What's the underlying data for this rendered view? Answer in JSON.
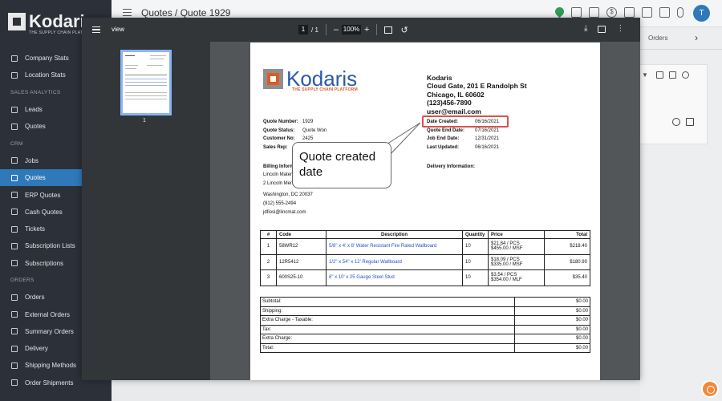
{
  "sidebar": {
    "logo_text": "Kodaris",
    "logo_sub": "THE SUPPLY CHAIN PLATFORM",
    "items": [
      {
        "label": "Company Stats"
      },
      {
        "label": "Location Stats"
      },
      {
        "section": "SALES ANALYTICS"
      },
      {
        "label": "Leads"
      },
      {
        "label": "Quotes"
      },
      {
        "section": "CRM"
      },
      {
        "label": "Jobs"
      },
      {
        "label": "Quotes",
        "active": true
      },
      {
        "label": "ERP Quotes"
      },
      {
        "label": "Cash Quotes"
      },
      {
        "label": "Tickets"
      },
      {
        "label": "Subscription Lists"
      },
      {
        "label": "Subscriptions"
      },
      {
        "section": "ORDERS"
      },
      {
        "label": "Orders"
      },
      {
        "label": "External Orders"
      },
      {
        "label": "Summary Orders"
      },
      {
        "label": "Delivery"
      },
      {
        "label": "Shipping Methods"
      },
      {
        "label": "Order Shipments"
      }
    ]
  },
  "topbar": {
    "title": "Quotes / Quote 1929",
    "avatar_initial": "T",
    "icons": [
      "location-icon",
      "truck-icon",
      "calendar-icon",
      "dollar-icon",
      "mail-icon",
      "chat-icon",
      "document-icon",
      "paperclip-icon"
    ]
  },
  "background": {
    "tab_orders": "Orders",
    "tab_next": "›"
  },
  "viewer": {
    "name": "view",
    "page_current": "1",
    "page_total": "/ 1",
    "zoom": "100%",
    "zoom_out": "–",
    "zoom_in": "+",
    "thumb_page": "1"
  },
  "document": {
    "logo_text": "Kodaris",
    "logo_sub": "THE SUPPLY CHAIN PLATFORM",
    "company": {
      "name": "Kodaris",
      "address1": "Cloud Gate, 201 E Randolph St",
      "address2": "Chicago, IL 60602",
      "phone": "(123)456-7890",
      "email": "user@email.com"
    },
    "quote_info": [
      {
        "key": "Quote Number:",
        "value": "1929"
      },
      {
        "key": "Quote Status:",
        "value": "Quote Won"
      },
      {
        "key": "Customer No:",
        "value": "2425"
      },
      {
        "key": "Sales Rep:",
        "value": ""
      }
    ],
    "dates": [
      {
        "key": "Date Created:",
        "value": "06/16/2021"
      },
      {
        "key": "Quote End Date:",
        "value": "07/16/2021"
      },
      {
        "key": "Job End Date:",
        "value": "12/31/2021"
      },
      {
        "key": "Last Updated:",
        "value": "06/16/2021"
      }
    ],
    "billing_label": "Billing Information:",
    "billing": {
      "line1": "Lincoln Materials",
      "line2": "2 Lincoln Memorial Cir NW",
      "line3": "Washington, DC 20037",
      "line4": "(812) 555-2494",
      "line5": "jdfiosi@lincmat.com"
    },
    "delivery_label": "Delivery Information:",
    "table_headers": {
      "num": "#",
      "code": "Code",
      "description": "Description",
      "quantity": "Quantity",
      "price": "Price",
      "total": "Total"
    },
    "items": [
      {
        "num": "1",
        "code": "58WR12",
        "description": "5/8\" x 4' x 8' Water Resistant Fire Rated Wallboard",
        "quantity": "10",
        "price1": "$21.84 / PCS",
        "price2": "$455.00 / MSF",
        "total": "$218.40"
      },
      {
        "num": "2",
        "code": "12R5412",
        "description": "1/2\" x 54\" x 12' Regular Wallboard",
        "quantity": "10",
        "price1": "$18.09 / PCS",
        "price2": "$335.00 / MSF",
        "total": "$180.90"
      },
      {
        "num": "3",
        "code": "600S25-10",
        "description": "6\" x 10' x 25 Gauge Steel Stud",
        "quantity": "10",
        "price1": "$3.54 / PCS",
        "price2": "$354.00 / MLF",
        "total": "$35.40"
      }
    ],
    "totals": [
      {
        "label": "Subtotal:",
        "value": "$0.00"
      },
      {
        "label": "Shipping:",
        "value": "$0.00"
      },
      {
        "label": "Extra Charge - Taxable:",
        "value": "$0.00"
      },
      {
        "label": "Tax:",
        "value": "$0.00"
      },
      {
        "label": "Extra Charge:",
        "value": "$0.00"
      },
      {
        "label": "Total:",
        "value": "$0.00"
      }
    ]
  },
  "callout": {
    "text": "Quote created date"
  },
  "colors": {
    "sidebar_bg": "#2b3039",
    "active_item": "#2f78b9",
    "brand_blue": "#2b5aa3",
    "brand_orange": "#e05a24",
    "highlight_red": "#d9534f",
    "viewer_bg": "#525659",
    "viewer_toolbar": "#323639"
  }
}
